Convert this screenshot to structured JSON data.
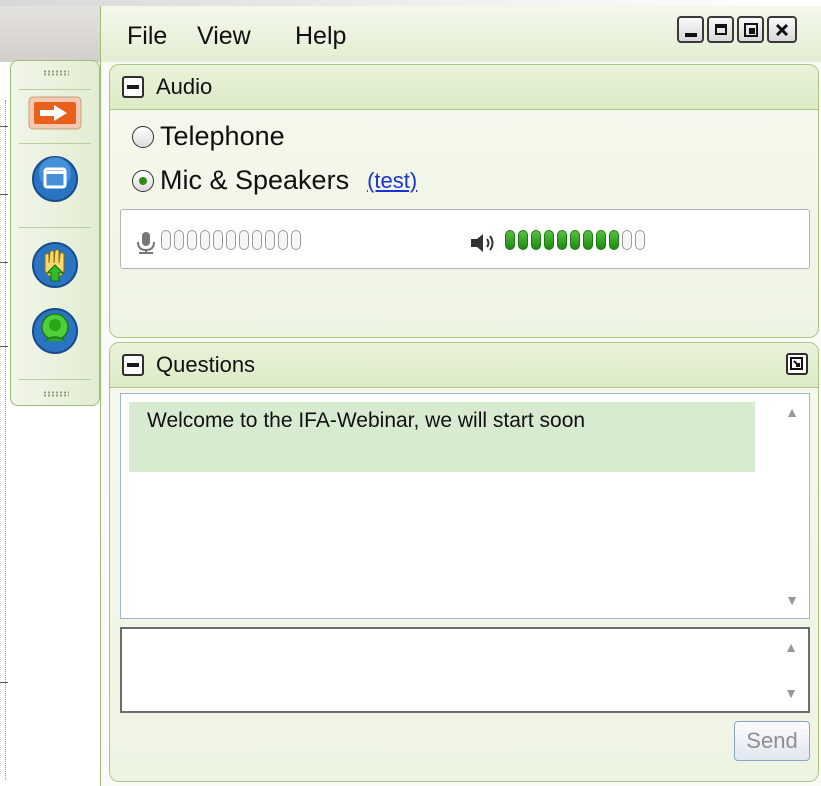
{
  "menu": {
    "file": "File",
    "view": "View",
    "help": "Help"
  },
  "window_controls": [
    "minimize-icon",
    "maximize-icon",
    "restore-icon",
    "close-icon"
  ],
  "toolbar": {
    "buttons": [
      "arrow-right-icon",
      "screen-icon",
      "raise-hand-icon",
      "microphone-icon"
    ]
  },
  "audio": {
    "title": "Audio",
    "option_telephone": "Telephone",
    "option_mic": "Mic & Speakers",
    "selected": "Mic & Speakers",
    "test_link": "(test)",
    "mic_level_lit": 0,
    "speaker_level_lit": 9,
    "segments": 11
  },
  "questions": {
    "title": "Questions",
    "messages": [
      "Welcome to the IFA-Webinar, we will start soon"
    ],
    "input_value": "",
    "send_label": "Send"
  },
  "colors": {
    "accent_green": "#2f8a17",
    "panel_border": "#a9c688",
    "link_blue": "#1b33d6",
    "arrow_orange": "#e8601c"
  }
}
